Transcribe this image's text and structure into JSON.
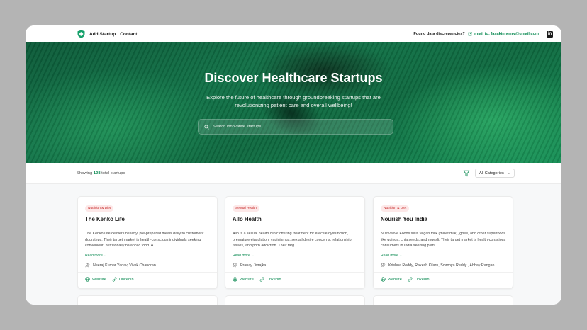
{
  "nav": {
    "add_startup": "Add Startup",
    "contact": "Contact",
    "discrepancy_q": "Found data discrepancies?",
    "email_label": "email to: fasakinhenry@gmail.com",
    "linkedin_glyph": "in"
  },
  "hero": {
    "title": "Discover Healthcare Startups",
    "subtitle": "Explore the future of healthcare through groundbreaking startups that are revolutionizing patient care and overall wellbeing!",
    "search_placeholder": "Search innovative startups..."
  },
  "filter": {
    "showing_prefix": "Showing",
    "count": "108",
    "showing_suffix": "total startups",
    "category": "All Categories"
  },
  "cards": [
    {
      "tag": "Nutrition & Diet",
      "title": "The Kenko Life",
      "desc": "The Kenko Life delivers healthy, pre-prepared meals daily to customers' doorsteps. Their target market is health-conscious individuals seeking convenient, nutritionally balanced food. A...",
      "read_more": "Read more",
      "founders": "Neeraj Kumar Yadav, Vivek Chandran",
      "website": "Website",
      "linkedin": "LinkedIn"
    },
    {
      "tag": "Sexual Health",
      "title": "Allo Health",
      "desc": "Allo is a sexual health clinic offering treatment for erectile dysfunction, premature ejaculation, vaginismus, sexual desire concerns, relationship issues, and porn addiction. Their targ...",
      "read_more": "Read more",
      "founders": "Pranay Jivrajka",
      "website": "Website",
      "linkedin": "LinkedIn"
    },
    {
      "tag": "Nutrition & Diet",
      "title": "Nourish You India",
      "desc": "Nutrivative Foods sells vegan milk (millet milk), ghee, and other superfoods like quinoa, chia seeds, and muesli. Their target market is health-conscious consumers in India seeking plant...",
      "read_more": "Read more",
      "founders": "Krishna Reddy, Rakesh Kilaru, Sowmya Reddy , Abhay Rangan",
      "website": "Website",
      "linkedin": "LinkedIn"
    }
  ],
  "colors": {
    "accent": "#0b8a52",
    "tag_text": "#c62828",
    "tag_bg": "#fde8e8"
  },
  "icons": {
    "logo": "shield-plus-icon",
    "external": "external-link-icon",
    "linkedin": "linkedin-icon",
    "search": "search-icon",
    "filter": "filter-icon",
    "chevron": "chevron-down-icon",
    "people": "users-icon",
    "globe": "globe-icon",
    "link": "link-icon"
  }
}
